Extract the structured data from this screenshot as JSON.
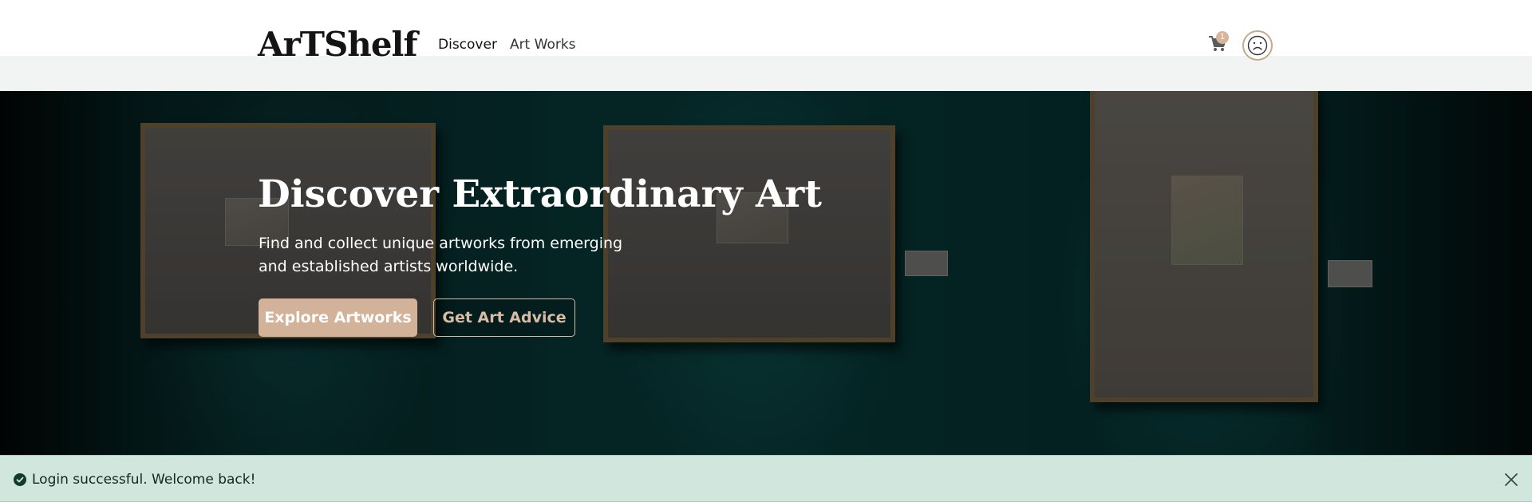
{
  "brand": {
    "logo_text": "ArTShelf"
  },
  "nav": {
    "items": [
      {
        "label": "Discover",
        "active": true
      },
      {
        "label": "Art Works",
        "active": false
      }
    ]
  },
  "header_actions": {
    "cart_icon": "shopping-cart-icon",
    "cart_count": "1",
    "avatar_icon": "sad-face-icon"
  },
  "hero": {
    "title": "Discover Extraordinary Art",
    "subtitle": "Find and collect unique artworks from emerging and established artists worldwide.",
    "primary_button": "Explore Artworks",
    "secondary_button": "Get Art Advice"
  },
  "alert": {
    "icon": "check-circle-icon",
    "message": "Login successful. Welcome back!",
    "close_icon": "close-icon"
  },
  "colors": {
    "accent": "#d3b29a",
    "alert_bg": "#d1e7dd",
    "hero_bg": "#063030"
  }
}
